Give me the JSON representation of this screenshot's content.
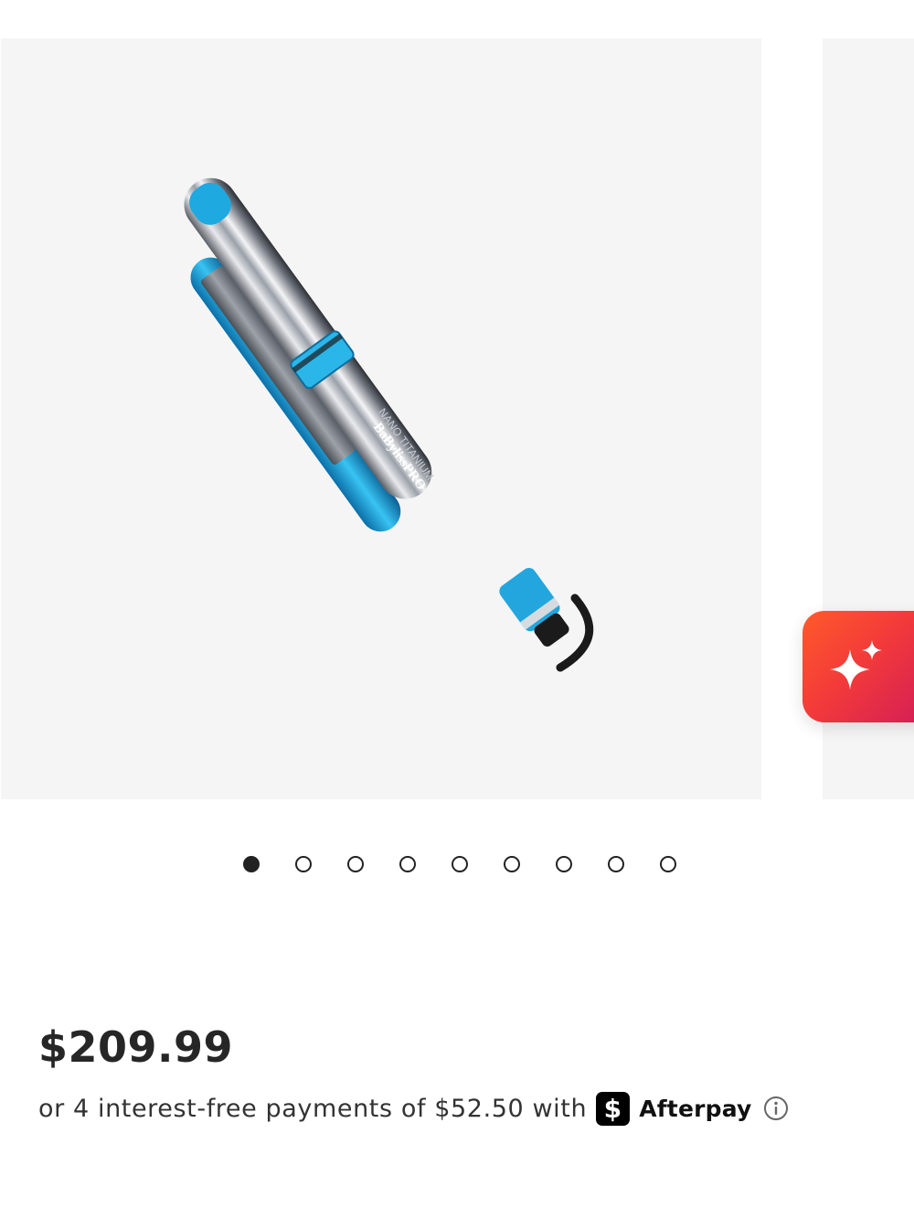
{
  "carousel": {
    "total_slides": 9,
    "active_index": 0,
    "product_image": {
      "brand_text": "BaByliss PRO",
      "model_text": "Nano Titanium",
      "colors": {
        "accent_blue": "#1da7de",
        "chrome": "#b8bcc2",
        "background": "#f5f5f5"
      }
    }
  },
  "ai_assistant": {
    "icon": "sparkle-icon",
    "colors": {
      "gradient_start": "#ff5a2a",
      "gradient_end": "#d01a5a"
    }
  },
  "pricing": {
    "price": "$209.99",
    "afterpay": {
      "text": "or 4 interest-free payments of $52.50 with",
      "logo_symbol": "$",
      "brand": "Afterpay",
      "info_icon": "info-icon"
    }
  }
}
